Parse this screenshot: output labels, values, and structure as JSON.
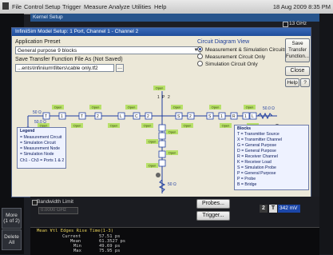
{
  "menubar": {
    "items": [
      "File",
      "Control",
      "Setup",
      "Trigger",
      "Measure",
      "Analyze",
      "Utilities",
      "Help"
    ],
    "datetime": "18 Aug 2009  8:35 PM"
  },
  "left_panel": {
    "more": "More\n(1 of 2)",
    "delete_all": "Delete\nAll"
  },
  "background": {
    "kernel_window_title": "Kernel Setup",
    "ghz": "13 GHz"
  },
  "dialog": {
    "title": "InfiniiSim Model Setup: 1 Port, Channel 1 - Channel 2",
    "application_preset_label": "Application Preset",
    "application_preset_value": "General purpose 9 blocks",
    "save_tf_label": "Save Transfer Function File As (Not Saved)",
    "save_tf_value": "...ents\\Infiniium\\filters\\cable only.tf2",
    "browse": "...",
    "circuit_view_label": "Circuit Diagram View",
    "view_options": [
      {
        "label": "Measurement & Simulation Circuits",
        "selected": true
      },
      {
        "label": "Measurement Circuit Only",
        "selected": false
      },
      {
        "label": "Simulation Circuit Only",
        "selected": false
      }
    ],
    "save_tf_button": "Save\nTransfer\nFunction...",
    "close_button": "Close",
    "help_button": "Help",
    "help_icon": "?"
  },
  "diagram": {
    "source_value": "50 Ω",
    "source_value2": "50.0 Ω",
    "load_value": "50.0 Ω",
    "bottom_value": "50 Ω",
    "blocks_top": [
      "T",
      "1",
      "T",
      "2",
      "L",
      "C",
      "2",
      "S",
      "2",
      "S",
      "1",
      "R",
      "1",
      "L"
    ],
    "tags": [
      "Open",
      "Open",
      "Open",
      "Open",
      "Open",
      "Open",
      "Open",
      "Open",
      "Open",
      "Open",
      "Open",
      "Open",
      "Open",
      "Open",
      "Open",
      "Open",
      "Open",
      "Open"
    ],
    "top_labels": [
      "1",
      "P",
      "2"
    ]
  },
  "legend": {
    "title": "Legend",
    "items": [
      "= Measurement Circuit",
      "= Simulation Circuit",
      "= Measurement Node",
      "= Simulation Node",
      "= Ports 1 & 2"
    ],
    "prefix": "Ch1 - Ch3"
  },
  "blocks_legend": {
    "title": "Blocks",
    "items": [
      "T = Transmitter Source",
      "X = Transmitter Channel",
      "G = General Purpose",
      "D = General Purpose",
      "R = Receiver Channel",
      "K = Receiver Load",
      "S = Simulation Probe",
      "P = General Purpose",
      "P = Probe",
      "B = Bridge"
    ]
  },
  "lower": {
    "bandwidth_label": "Bandwidth Limit",
    "frequency_placeholder": "0.0000 GHz",
    "probes_button": "Probes...",
    "trigger_button": "Trigger...",
    "ch_square1": "2",
    "ch_square2": "T",
    "mv_value": "342 mV"
  },
  "measurements": {
    "header": "Mean Ɐtl Edges  Rise Time(1-3)",
    "rows": [
      {
        "name": "Current",
        "value": "57.51 ps"
      },
      {
        "name": "Mean",
        "value": "61.3527 ps"
      },
      {
        "name": "Min",
        "value": "49.69 ps"
      },
      {
        "name": "Max",
        "value": "75.95 ps"
      }
    ]
  },
  "colors": {
    "title_bar": "#1f4d9a",
    "dialog_bg": "#ece8d8",
    "wire": "#1e3da0",
    "tag_open": "#b8e06a",
    "block_fill": "#ffffff",
    "accent_blue": "#1b46a8"
  }
}
